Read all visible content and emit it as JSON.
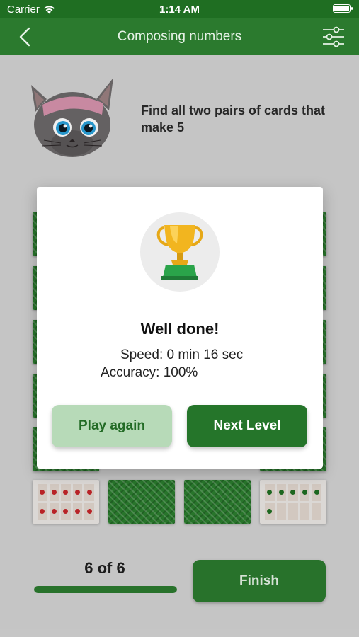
{
  "status_bar": {
    "carrier": "Carrier",
    "time": "1:14 AM"
  },
  "nav": {
    "title": "Composing numbers",
    "back_icon": "chevron-left-icon",
    "settings_icon": "sliders-icon"
  },
  "task": {
    "instruction": "Find all two pairs of cards that make 5"
  },
  "bottom_cards": [
    {
      "type": "face",
      "dot_color": "red",
      "top_dots": 5,
      "bottom_dots": 5
    },
    {
      "type": "back"
    },
    {
      "type": "back"
    },
    {
      "type": "face",
      "dot_color": "green",
      "top_dots": 5,
      "bottom_dots": 1
    }
  ],
  "progress": {
    "label": "6 of 6",
    "fraction": 1.0
  },
  "finish_label": "Finish",
  "result_dialog": {
    "icon": "trophy-icon",
    "headline": "Well done!",
    "speed": "Speed: 0 min 16 sec",
    "accuracy": "Accuracy: 100%",
    "play_again_label": "Play again",
    "next_level_label": "Next Level"
  },
  "colors": {
    "primary": "#2b7a2e",
    "primary_dark": "#1f6e22",
    "secondary_button": "#b7dab8",
    "dot_red": "#c4262a"
  }
}
